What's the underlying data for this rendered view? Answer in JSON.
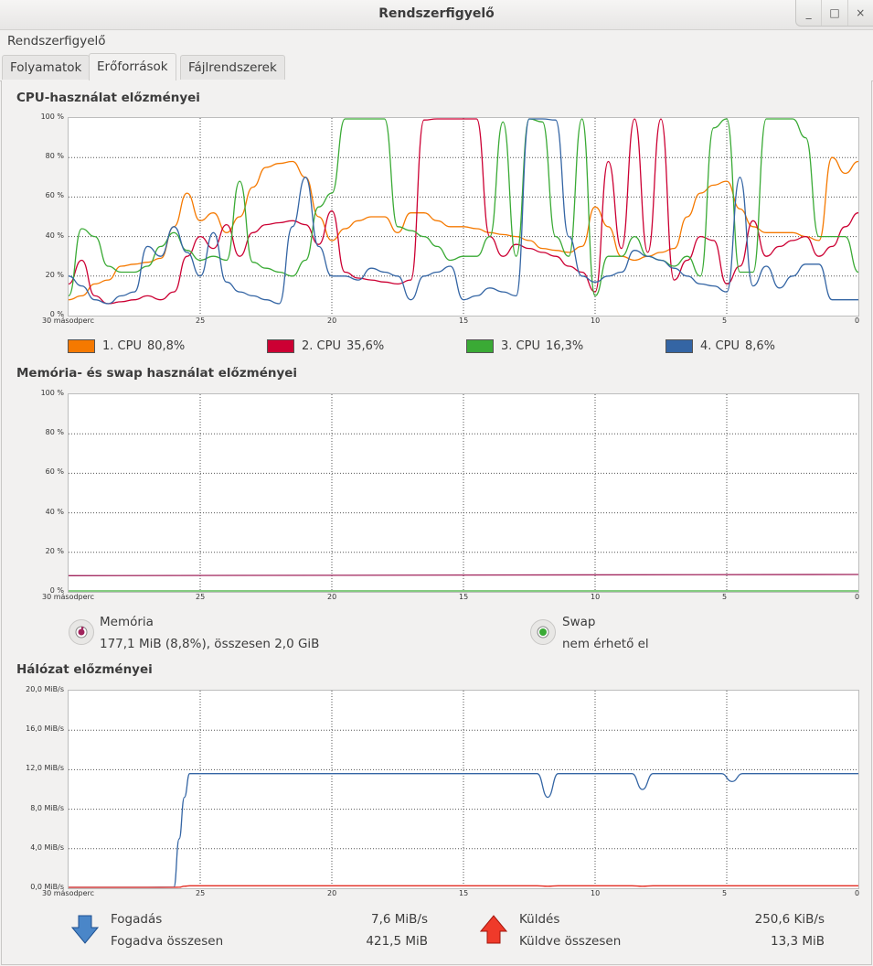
{
  "window": {
    "title": "Rendszerfigyelő",
    "controls": [
      "_",
      "□",
      "×"
    ]
  },
  "menu": {
    "items": [
      "Rendszerfigyelő"
    ]
  },
  "tabs": [
    "Folyamatok",
    "Erőforrások",
    "Fájlrendszerek"
  ],
  "active_tab": "Erőforrások",
  "cpu_section": {
    "title": "CPU-használat előzményei",
    "cpus": [
      {
        "label": "1. CPU",
        "value": "80,8%",
        "color": "#f57900"
      },
      {
        "label": "2. CPU",
        "value": "35,6%",
        "color": "#cc0033"
      },
      {
        "label": "3. CPU",
        "value": "16,3%",
        "color": "#3aaa35"
      },
      {
        "label": "4. CPU",
        "value": "8,6%",
        "color": "#3465a4"
      }
    ]
  },
  "memory_section": {
    "title": "Memória- és swap használat előzményei",
    "memory": {
      "label": "Memória",
      "value": "177,1 MiB (8,8%), összesen 2,0 GiB",
      "color": "#a0245c"
    },
    "swap": {
      "label": "Swap",
      "value": "nem érhető el",
      "color": "#3aaa35"
    }
  },
  "network_section": {
    "title": "Hálózat előzményei",
    "receiving": {
      "label": "Fogadás",
      "value": "7,6 MiB/s",
      "total_label": "Fogadva összesen",
      "total_value": "421,5 MiB",
      "color": "#3465a4"
    },
    "sending": {
      "label": "Küldés",
      "value": "250,6 KiB/s",
      "total_label": "Küldve összesen",
      "total_value": "13,3 MiB",
      "color": "#e32c22"
    }
  },
  "axes": {
    "x_ticks": [
      "30 másodperc",
      "25",
      "20",
      "15",
      "10",
      "5",
      "0"
    ],
    "pct_ticks": [
      "100 %",
      "80 %",
      "60 %",
      "40 %",
      "20 %",
      "0 %"
    ],
    "net_ticks": [
      "20,0 MiB/s",
      "16,0 MiB/s",
      "12,0 MiB/s",
      "8,0 MiB/s",
      "4,0 MiB/s",
      "0,0 MiB/s"
    ]
  },
  "chart_data": [
    {
      "type": "line",
      "title": "CPU-használat előzményei",
      "x": [
        30,
        29.5,
        29,
        28.5,
        28,
        27.5,
        27,
        26.5,
        26,
        25.5,
        25,
        24.5,
        24,
        23.5,
        23,
        22.5,
        22,
        21.5,
        21,
        20.5,
        20,
        19.5,
        19,
        18.5,
        18,
        17.5,
        17,
        16.5,
        16,
        15.5,
        15,
        14.5,
        14,
        13.5,
        13,
        12.5,
        12,
        11.5,
        11,
        10.5,
        10,
        9.5,
        9,
        8.5,
        8,
        7.5,
        7,
        6.5,
        6,
        5.5,
        5,
        4.5,
        4,
        3.5,
        3,
        2.5,
        2,
        1.5,
        1,
        0.5,
        0
      ],
      "xlim": [
        30,
        0
      ],
      "ylim": [
        0,
        100
      ],
      "series": [
        {
          "name": "1. CPU",
          "values": [
            8,
            10,
            16,
            18,
            25,
            26,
            27,
            29,
            45,
            62,
            48,
            52,
            42,
            50,
            65,
            75,
            77,
            78,
            70,
            50,
            38,
            44,
            48,
            50,
            50,
            42,
            52,
            52,
            48,
            45,
            45,
            44,
            42,
            41,
            40,
            38,
            34,
            33,
            32,
            35,
            55,
            45,
            30,
            28,
            30,
            32,
            34,
            50,
            62,
            66,
            68,
            54,
            45,
            42,
            42,
            42,
            40,
            38,
            80,
            72,
            78
          ]
        },
        {
          "name": "2. CPU",
          "values": [
            16,
            28,
            10,
            6,
            7,
            8,
            10,
            8,
            12,
            30,
            40,
            34,
            46,
            30,
            42,
            46,
            47,
            48,
            46,
            36,
            53,
            22,
            19,
            18,
            17,
            16,
            18,
            99,
            100,
            100,
            100,
            100,
            40,
            30,
            36,
            34,
            32,
            30,
            25,
            22,
            12,
            78,
            34,
            100,
            32,
            100,
            18,
            28,
            40,
            38,
            16,
            25,
            48,
            30,
            35,
            38,
            40,
            30,
            35,
            45,
            52
          ]
        },
        {
          "name": "3. CPU",
          "values": [
            10,
            44,
            40,
            25,
            22,
            22,
            25,
            35,
            42,
            33,
            28,
            30,
            28,
            68,
            27,
            24,
            22,
            20,
            28,
            55,
            62,
            100,
            100,
            100,
            100,
            45,
            43,
            40,
            35,
            28,
            30,
            30,
            40,
            98,
            30,
            100,
            98,
            40,
            30,
            100,
            10,
            30,
            30,
            40,
            30,
            28,
            25,
            30,
            20,
            95,
            100,
            22,
            22,
            100,
            100,
            100,
            90,
            40,
            40,
            40,
            22
          ]
        },
        {
          "name": "4. CPU",
          "values": [
            20,
            15,
            8,
            6,
            10,
            12,
            35,
            30,
            45,
            32,
            20,
            42,
            17,
            12,
            10,
            8,
            6,
            45,
            70,
            35,
            20,
            20,
            18,
            24,
            22,
            20,
            8,
            20,
            22,
            25,
            8,
            10,
            14,
            12,
            10,
            100,
            100,
            99,
            40,
            20,
            17,
            20,
            22,
            33,
            30,
            28,
            24,
            20,
            16,
            15,
            12,
            70,
            15,
            25,
            14,
            20,
            26,
            26,
            8,
            8,
            8
          ]
        }
      ]
    },
    {
      "type": "line",
      "title": "Memória- és swap használat előzményei",
      "x": [
        30,
        0
      ],
      "xlim": [
        30,
        0
      ],
      "ylim": [
        0,
        100
      ],
      "series": [
        {
          "name": "Memória",
          "values": [
            8.2,
            8.8
          ]
        },
        {
          "name": "Swap",
          "values": [
            0,
            0
          ]
        }
      ]
    },
    {
      "type": "line",
      "title": "Hálózat előzményei",
      "x": [
        30,
        27,
        26,
        25.8,
        25.6,
        25.4,
        25,
        24,
        20,
        15,
        12.2,
        11.8,
        11.4,
        11,
        8.6,
        8.2,
        7.8,
        5.2,
        4.8,
        4.4,
        0
      ],
      "xlim": [
        30,
        0
      ],
      "ylim": [
        0,
        20
      ],
      "series": [
        {
          "name": "Fogadás",
          "values": [
            0,
            0,
            0.1,
            5,
            9.2,
            11.6,
            11.6,
            11.6,
            11.6,
            11.6,
            11.6,
            9.2,
            11.6,
            11.6,
            11.6,
            10.0,
            11.6,
            11.6,
            10.8,
            11.6,
            11.6
          ]
        },
        {
          "name": "Küldés",
          "values": [
            0,
            0,
            0,
            0.1,
            0.2,
            0.25,
            0.25,
            0.25,
            0.25,
            0.25,
            0.25,
            0.2,
            0.25,
            0.25,
            0.25,
            0.2,
            0.25,
            0.25,
            0.25,
            0.25,
            0.25
          ]
        }
      ]
    }
  ]
}
